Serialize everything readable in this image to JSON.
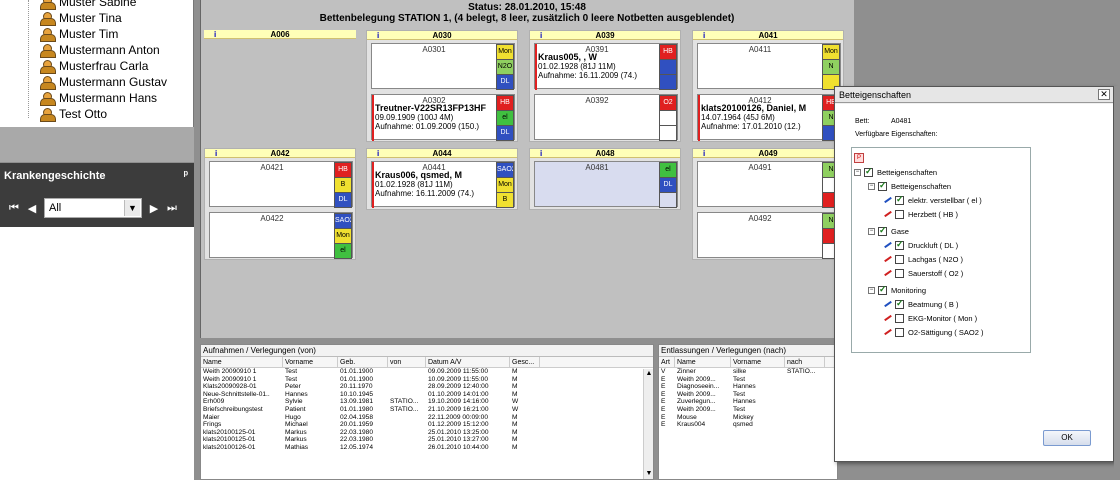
{
  "patients_tree": [
    "Muster Sabine",
    "Muster Tina",
    "Muster Tim",
    "Mustermann Anton",
    "Musterfrau Carla",
    "Mustermann Gustav",
    "Mustermann Hans",
    "Test Otto"
  ],
  "krankengeschichte": {
    "title": "Krankengeschichte",
    "pin": "ᵖ",
    "filter_value": "All",
    "first": "⏮",
    "prev": "◀",
    "next": "▶",
    "last": "⏭"
  },
  "status": {
    "line1": "Status: 28.01.2010, 15:48",
    "line2": "Bettenbelegung STATION 1, (4 belegt, 8 leer, zusätzlich 0 leere Notbetten ausgeblendet)"
  },
  "rooms": [
    {
      "name": "A006",
      "info": "i",
      "beds": []
    },
    {
      "name": "A030",
      "info": "i",
      "beds": [
        {
          "id": "A0301",
          "patient": "",
          "lines": [],
          "tags": [
            {
              "t": "Mon",
              "c": "#f0e030"
            },
            {
              "t": "N2O",
              "c": "#8fd060"
            },
            {
              "t": "DL",
              "c": "#3050c0"
            }
          ]
        },
        {
          "id": "A0302",
          "patient": "Treutner-V22SR13FP13HF",
          "lines": [
            "09.09.1909 (100J 4M)",
            "Aufnahme: 01.09.2009 (150.)"
          ],
          "tags": [
            {
              "t": "HB",
              "c": "#e02020"
            },
            {
              "t": "el",
              "c": "#40c040"
            },
            {
              "t": "DL",
              "c": "#3050c0"
            }
          ]
        }
      ]
    },
    {
      "name": "A039",
      "info": "i",
      "beds": [
        {
          "id": "A0391",
          "patient": "Kraus005, , W",
          "lines": [
            "01.02.1928 (81J 11M)",
            "Aufnahme: 16.11.2009 (74.)"
          ],
          "tags": [
            {
              "t": "HB",
              "c": "#e02020"
            },
            {
              "t": "",
              "c": "#3050c0"
            },
            {
              "t": "",
              "c": "#3050c0"
            }
          ]
        },
        {
          "id": "A0392",
          "patient": "",
          "lines": [],
          "tags": [
            {
              "t": "O2",
              "c": "#e02020"
            },
            {
              "t": "",
              "c": "#ffffff"
            },
            {
              "t": "",
              "c": "#ffffff"
            }
          ]
        }
      ]
    },
    {
      "name": "A041",
      "info": "i",
      "beds": [
        {
          "id": "A0411",
          "patient": "",
          "lines": [],
          "tags": [
            {
              "t": "Mon",
              "c": "#f0e030"
            },
            {
              "t": "N",
              "c": "#8fd060"
            },
            {
              "t": "",
              "c": "#f0e030"
            }
          ]
        },
        {
          "id": "A0412",
          "patient": "klats20100126, Daniel, M",
          "lines": [
            "14.07.1964 (45J 6M)",
            "Aufnahme: 17.01.2010 (12.)"
          ],
          "tags": [
            {
              "t": "HB",
              "c": "#e02020"
            },
            {
              "t": "N",
              "c": "#8fd060"
            },
            {
              "t": "",
              "c": "#3050c0"
            }
          ]
        }
      ]
    },
    {
      "name": "A042",
      "info": "i",
      "beds": [
        {
          "id": "A0421",
          "patient": "",
          "lines": [],
          "tags": [
            {
              "t": "HB",
              "c": "#e02020"
            },
            {
              "t": "B",
              "c": "#f0e030"
            },
            {
              "t": "DL",
              "c": "#3050c0"
            }
          ]
        },
        {
          "id": "A0422",
          "patient": "",
          "lines": [],
          "tags": [
            {
              "t": "SAO2",
              "c": "#3050c0"
            },
            {
              "t": "Mon",
              "c": "#f0e030"
            },
            {
              "t": "el",
              "c": "#40c040"
            }
          ]
        }
      ]
    },
    {
      "name": "A044",
      "info": "i",
      "beds": [
        {
          "id": "A0441",
          "patient": "Kraus006, qsmed, M",
          "lines": [
            "01.02.1928 (81J 11M)",
            "Aufnahme: 16.11.2009 (74.)"
          ],
          "tags": [
            {
              "t": "SAO2",
              "c": "#3050c0"
            },
            {
              "t": "Mon",
              "c": "#f0e030"
            },
            {
              "t": "B",
              "c": "#f0e030"
            }
          ]
        }
      ]
    },
    {
      "name": "A048",
      "info": "i",
      "beds": [
        {
          "id": "A0481",
          "patient": "",
          "lines": [],
          "tags": [
            {
              "t": "el",
              "c": "#40c040"
            },
            {
              "t": "DL",
              "c": "#3050c0"
            },
            {
              "t": "",
              "c": "#d8dcef"
            }
          ]
        }
      ]
    },
    {
      "name": "A049",
      "info": "i",
      "beds": [
        {
          "id": "A0491",
          "patient": "",
          "lines": [],
          "tags": [
            {
              "t": "N",
              "c": "#8fd060"
            },
            {
              "t": "",
              "c": "#ffffff"
            },
            {
              "t": "",
              "c": "#e02020"
            }
          ]
        },
        {
          "id": "A0492",
          "patient": "",
          "lines": [],
          "tags": [
            {
              "t": "N",
              "c": "#8fd060"
            },
            {
              "t": "",
              "c": "#e02020"
            },
            {
              "t": "",
              "c": "#ffffff"
            }
          ]
        }
      ]
    }
  ],
  "admissions": {
    "title": "Aufnahmen / Verlegungen (von)",
    "columns": [
      "Name",
      "Vorname",
      "Geb.",
      "von",
      "Datum A/V",
      "Gesc..."
    ],
    "rows": [
      [
        "Weith 20090910 1",
        "Test",
        "01.01.1900",
        "",
        "09.09.2009 11:55:00",
        "M"
      ],
      [
        "Weith 20090910 1",
        "Test",
        "01.01.1900",
        "",
        "10.09.2009 11:55:00",
        "M"
      ],
      [
        "Klats20090928-01",
        "Peter",
        "20.11.1970",
        "",
        "28.09.2009 12:40:00",
        "M"
      ],
      [
        "Neue-Schnittstelle-01..",
        "Hannes",
        "10.10.1945",
        "",
        "01.10.2009 14:01:00",
        "M"
      ],
      [
        "Erh009",
        "Sylvie",
        "13.09.1981",
        "STATIO...",
        "19.10.2009 14:16:00",
        "W"
      ],
      [
        "Briefschreibungstest",
        "Patient",
        "01.01.1980",
        "STATIO...",
        "21.10.2009 16:21:00",
        "W"
      ],
      [
        "Maier",
        "Hugo",
        "02.04.1958",
        "",
        "22.11.2009 00:09:00",
        "M"
      ],
      [
        "Frings",
        "Michael",
        "20.01.1959",
        "",
        "01.12.2009 15:12:00",
        "M"
      ],
      [
        "klats20100125-01",
        "Markus",
        "22.03.1980",
        "",
        "25.01.2010 13:25:00",
        "M"
      ],
      [
        "klats20100125-01",
        "Markus",
        "22.03.1980",
        "",
        "25.01.2010 13:27:00",
        "M"
      ],
      [
        "klats20100126-01",
        "Mathias",
        "12.05.1974",
        "",
        "26.01.2010 10:44:00",
        "M"
      ]
    ]
  },
  "discharges": {
    "title": "Entlassungen / Verlegungen (nach)",
    "columns": [
      "Art",
      "Name",
      "Vorname",
      "nach"
    ],
    "rows": [
      [
        "V",
        "Zinner",
        "silke",
        "STATIO..."
      ],
      [
        "E",
        "Weith 2009...",
        "Test",
        ""
      ],
      [
        "E",
        "Diagnoseein...",
        "Hannes",
        ""
      ],
      [
        "E",
        "Weith 2009...",
        "Test",
        ""
      ],
      [
        "E",
        "Zuverlegun...",
        "Hannes",
        ""
      ],
      [
        "E",
        "Weith 2009...",
        "Test",
        ""
      ],
      [
        "E",
        "Mouse",
        "Mickey",
        ""
      ],
      [
        "E",
        "Kraus004",
        "qsmed",
        ""
      ]
    ]
  },
  "dialog": {
    "title": "Betteigenschaften",
    "close": "✕",
    "bett_label": "Bett:",
    "bett_value": "A0481",
    "available_label": "Verfügbare Eigenschaften:",
    "root": "Betteigenschaften",
    "groups": [
      {
        "name": "Betteigenschaften",
        "items": [
          {
            "label": "elektr. verstellbar ( el )",
            "on": true
          },
          {
            "label": "Herzbett ( HB )",
            "on": false
          }
        ]
      },
      {
        "name": "Gase",
        "items": [
          {
            "label": "Druckluft ( DL )",
            "on": true
          },
          {
            "label": "Lachgas ( N2O )",
            "on": false
          },
          {
            "label": "Sauerstoff ( O2 )",
            "on": false
          }
        ]
      },
      {
        "name": "Monitoring",
        "items": [
          {
            "label": "Beatmung ( B )",
            "on": true
          },
          {
            "label": "EKG-Monitor ( Mon )",
            "on": false
          },
          {
            "label": "O2-Sättigung ( SAO2 )",
            "on": false
          }
        ]
      }
    ],
    "ok": "OK"
  }
}
